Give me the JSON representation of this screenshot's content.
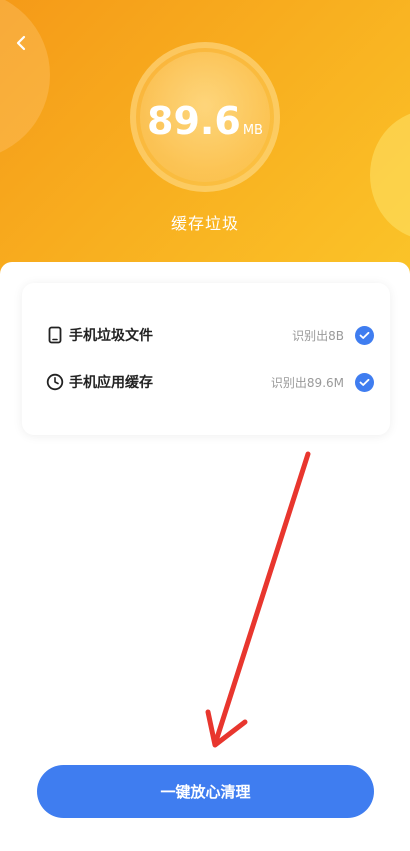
{
  "header": {
    "size_value": "89.6",
    "size_unit": "MB",
    "title": "缓存垃圾",
    "gradient_start": "#f59a18",
    "gradient_end": "#fbc529"
  },
  "items": [
    {
      "label": "手机垃圾文件",
      "status": "识别出8B",
      "icon": "phone-icon",
      "checked": true
    },
    {
      "label": "手机应用缓存",
      "status": "识别出89.6M",
      "icon": "clock-icon",
      "checked": true
    }
  ],
  "action": {
    "clean_label": "一键放心清理",
    "button_color": "#3f7df0"
  },
  "annotation": {
    "arrow_color": "#e8362e"
  }
}
